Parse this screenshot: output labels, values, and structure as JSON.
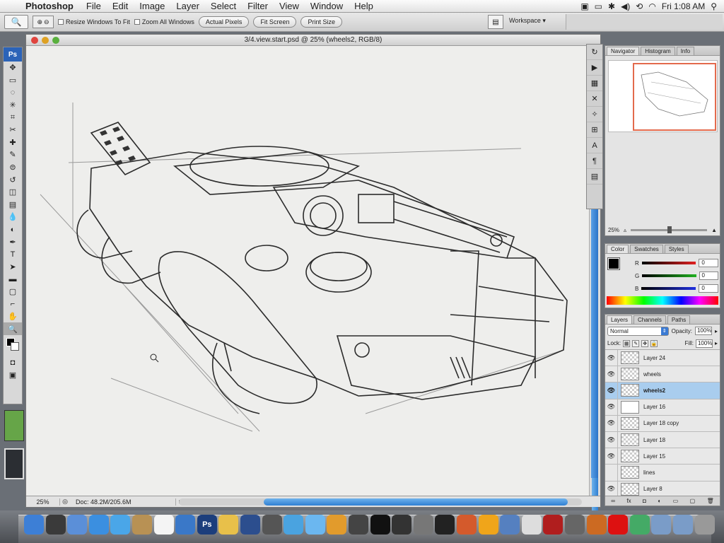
{
  "menubar": {
    "app_name": "Photoshop",
    "menus": [
      "File",
      "Edit",
      "Image",
      "Layer",
      "Select",
      "Filter",
      "View",
      "Window",
      "Help"
    ],
    "clock": "Fri 1:08 AM"
  },
  "options_bar": {
    "resize_windows": "Resize Windows To Fit",
    "zoom_all": "Zoom All Windows",
    "actual_pixels": "Actual Pixels",
    "fit_screen": "Fit Screen",
    "print_size": "Print Size",
    "workspace": "Workspace ▾"
  },
  "toolbox": {
    "header": "Ps",
    "tools": [
      "move-icon",
      "marquee-icon",
      "lasso-icon",
      "magic-wand-icon",
      "crop-icon",
      "slice-icon",
      "healing-icon",
      "brush-icon",
      "clone-stamp-icon",
      "history-brush-icon",
      "eraser-icon",
      "gradient-icon",
      "blur-icon",
      "dodge-icon",
      "pen-icon",
      "type-icon",
      "path-select-icon",
      "shape-icon",
      "notes-icon",
      "eyedropper-icon",
      "hand-icon",
      "zoom-icon"
    ],
    "glyphs": [
      "✥",
      "▭",
      "◌",
      "✳",
      "⌗",
      "✂",
      "✚",
      "✎",
      "⊜",
      "↺",
      "◫",
      "▤",
      "💧",
      "◐",
      "✒",
      "T",
      "➤",
      "▬",
      "▢",
      "⌐",
      "✋",
      "🔍"
    ]
  },
  "document": {
    "title": "3/4.view.start.psd @ 25% (wheels2, RGB/8)",
    "zoom": "25%",
    "doc_size": "Doc: 48.2M/205.6M"
  },
  "navigator": {
    "tabs": [
      "Navigator",
      "Histogram",
      "Info"
    ],
    "zoom": "25%"
  },
  "color_panel": {
    "tabs": [
      "Color",
      "Swatches",
      "Styles"
    ],
    "channels": [
      {
        "label": "R",
        "value": "0",
        "color": "#e02020"
      },
      {
        "label": "G",
        "value": "0",
        "color": "#20b020"
      },
      {
        "label": "B",
        "value": "0",
        "color": "#2030e0"
      }
    ]
  },
  "layers_panel": {
    "tabs": [
      "Layers",
      "Channels",
      "Paths"
    ],
    "blend_mode": "Normal",
    "opacity_label": "Opacity:",
    "opacity": "100%",
    "lock_label": "Lock:",
    "fill_label": "Fill:",
    "fill": "100%",
    "layers": [
      {
        "name": "Layer 24",
        "visible": true,
        "selected": false
      },
      {
        "name": "wheels",
        "visible": true,
        "selected": false
      },
      {
        "name": "wheels2",
        "visible": true,
        "selected": true
      },
      {
        "name": "Layer 16",
        "visible": true,
        "selected": false
      },
      {
        "name": "Layer 18 copy",
        "visible": true,
        "selected": false
      },
      {
        "name": "Layer 18",
        "visible": true,
        "selected": false
      },
      {
        "name": "Layer 15",
        "visible": true,
        "selected": false
      },
      {
        "name": "lines",
        "visible": false,
        "selected": false
      },
      {
        "name": "Layer 8",
        "visible": true,
        "selected": false
      }
    ]
  },
  "dock": {
    "apps": [
      "Finder",
      "Dashboard",
      "Mail",
      "Safari",
      "iChat",
      "Address Book",
      "iCal",
      "Preview",
      "Photoshop",
      "Illustrator",
      "Bridge",
      "Sketch",
      "iPhoto",
      "iTunes",
      "GarageBand",
      "FileMerge",
      "DVD Player",
      "Expose",
      "System Preferences",
      "Terminal",
      "Keynote",
      "Pages",
      "Utility",
      "Font Book",
      "Acrobat",
      "Camera",
      "Misc",
      "Flash",
      "iMovie",
      "Documents",
      "Downloads",
      "Trash"
    ],
    "colors": [
      "#3d7fd6",
      "#3a3a3a",
      "#5b8fd8",
      "#3b8fe0",
      "#4aa6e8",
      "#b89154",
      "#f4f4f4",
      "#3a78c8",
      "#1c3e7c",
      "#e8c04a",
      "#2c4e8e",
      "#555",
      "#4aa3e0",
      "#6bb7f0",
      "#e29b2c",
      "#444",
      "#111",
      "#333",
      "#777",
      "#222",
      "#d45a2c",
      "#f0a51a",
      "#5580c0",
      "#ddd",
      "#b01e1e",
      "#666",
      "#cc6a22",
      "#d11",
      "#4a6",
      "#7a9cc8",
      "#7a9cc8",
      "#999"
    ]
  }
}
